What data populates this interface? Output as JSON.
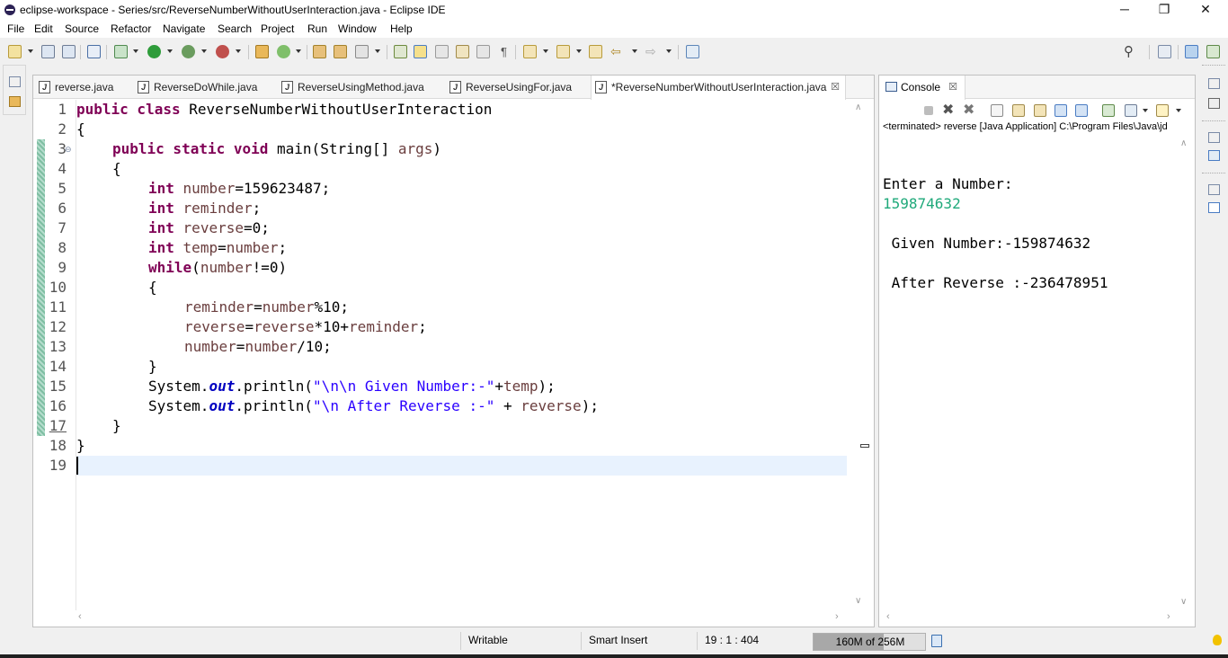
{
  "window": {
    "title": "eclipse-workspace - Series/src/ReverseNumberWithoutUserInteraction.java - Eclipse IDE",
    "minimize": "─",
    "maximize": "❐",
    "close": "✕"
  },
  "menu": {
    "file": "File",
    "edit": "Edit",
    "source": "Source",
    "refactor": "Refactor",
    "navigate": "Navigate",
    "search": "Search",
    "project": "Project",
    "run": "Run",
    "window": "Window",
    "help": "Help"
  },
  "editor": {
    "tabs": [
      {
        "label": "reverse.java"
      },
      {
        "label": "ReverseDoWhile.java"
      },
      {
        "label": "ReverseUsingMethod.java"
      },
      {
        "label": "ReverseUsingFor.java"
      },
      {
        "label": "*ReverseNumberWithoutUserInteraction.java"
      }
    ],
    "close_glyph": "☒",
    "line_numbers": [
      "1",
      "2",
      "3",
      "4",
      "5",
      "6",
      "7",
      "8",
      "9",
      "10",
      "11",
      "12",
      "13",
      "14",
      "15",
      "16",
      "17",
      "18",
      "19"
    ],
    "code": {
      "l1_kw": "public class",
      "l1_rest": " ReverseNumberWithoutUserInteraction",
      "l2": "{",
      "l3_kw": "public static void",
      "l3_rest": " main(String[] ",
      "l3_var": "args",
      "l3_end": ")",
      "l4": "{",
      "l5_kw": "int",
      "l5_var": "number",
      "l5_rest": "=159623487;",
      "l6_kw": "int",
      "l6_var": "reminder",
      "l6_rest": ";",
      "l7_kw": "int",
      "l7_var": "reverse",
      "l7_rest": "=0;",
      "l8_kw": "int",
      "l8_var": "temp",
      "l8_eq": "=",
      "l8_var2": "number",
      "l8_rest": ";",
      "l9_kw": "while",
      "l9_open": "(",
      "l9_var": "number",
      "l9_rest": "!=0)",
      "l10": "{",
      "l11_var": "reminder",
      "l11_eq": "=",
      "l11_var2": "number",
      "l11_rest": "%10;",
      "l12_var": "reverse",
      "l12_eq": "=",
      "l12_var2": "reverse",
      "l12_mid": "*10+",
      "l12_var3": "reminder",
      "l12_rest": ";",
      "l13_var": "number",
      "l13_eq": "=",
      "l13_var2": "number",
      "l13_rest": "/10;",
      "l14": "}",
      "l15_a": "System.",
      "l15_out": "out",
      "l15_b": ".println(",
      "l15_str": "\"\\n\\n Given Number:-\"",
      "l15_plus": "+",
      "l15_var": "temp",
      "l15_end": ");",
      "l16_a": "System.",
      "l16_out": "out",
      "l16_b": ".println(",
      "l16_str": "\"\\n After Reverse :-\"",
      "l16_plus": " + ",
      "l16_var": "reverse",
      "l16_end": ");",
      "l17": "}",
      "l18": "}"
    }
  },
  "console": {
    "tab_label": "Console",
    "status": "<terminated> reverse [Java Application] C:\\Program Files\\Java\\jd",
    "prompt": "Enter a Number:",
    "input": "159874632",
    "given": " Given Number:-159874632",
    "after": " After Reverse :-236478951"
  },
  "statusbar": {
    "writable": "Writable",
    "insert_mode": "Smart Insert",
    "position": "19 : 1 : 404",
    "heap": "160M of 256M",
    "heap_used_fraction": 0.625
  },
  "colors": {
    "keyword": "#7f0055",
    "variable": "#6a3e3e",
    "string": "#2a00ff",
    "field": "#0000c0",
    "console_input": "#1fa97a",
    "current_line": "#e8f2fe"
  }
}
